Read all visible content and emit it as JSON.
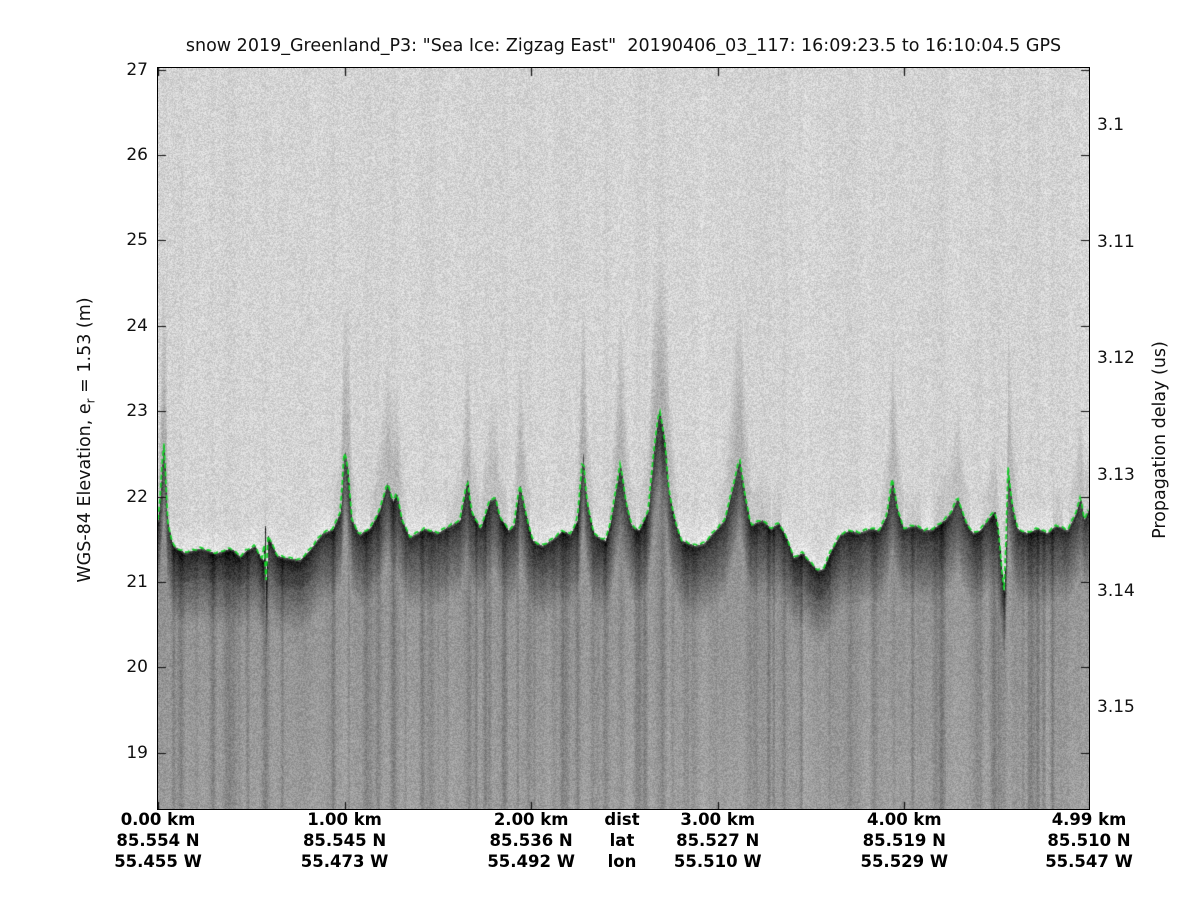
{
  "title": "snow 2019_Greenland_P3: \"Sea Ice: Zigzag East\"  20190406_03_117: 16:09:23.5 to 16:10:04.5 GPS",
  "axes": {
    "left": {
      "label_prefix": "WGS-84 Elevation, e",
      "label_sub": "r",
      "label_suffix": " = 1.53 (m)",
      "ticks": [
        27,
        26,
        25,
        24,
        23,
        22,
        21,
        20,
        19
      ]
    },
    "right": {
      "label": "Propagation delay (us)",
      "ticks": [
        3.1,
        3.11,
        3.12,
        3.13,
        3.14,
        3.15
      ],
      "tick_labels": [
        "3.1",
        "3.11",
        "3.12",
        "3.13",
        "3.14",
        "3.15"
      ]
    },
    "bottom": {
      "key": {
        "dist": "dist",
        "lat": "lat",
        "lon": "lon"
      },
      "columns": [
        {
          "km": 0,
          "dist": "0.00 km",
          "lat": "85.554 N",
          "lon": "55.455 W"
        },
        {
          "km": 1,
          "dist": "1.00 km",
          "lat": "85.545 N",
          "lon": "55.473 W"
        },
        {
          "km": 2,
          "dist": "2.00 km",
          "lat": "85.536 N",
          "lon": "55.492 W"
        },
        {
          "km": 3,
          "dist": "3.00 km",
          "lat": "85.527 N",
          "lon": "55.510 W"
        },
        {
          "km": 4,
          "dist": "4.00 km",
          "lat": "85.519 N",
          "lon": "55.529 W"
        },
        {
          "km": 4.99,
          "dist": "4.99 km",
          "lat": "85.510 N",
          "lon": "55.547 W"
        }
      ]
    }
  },
  "chart_data": {
    "type": "heatmap",
    "description": "Grayscale snow-radar echogram of sea ice (light speckle above surface, dark surface return band near 21.6 m, medium-gray subsurface clutter with vertical streaks) with a dashed green tracked-surface line overlay.",
    "xlim": [
      0,
      4.99
    ],
    "ylim_left": [
      27.02,
      18.33
    ],
    "ylim_right": [
      3.0951,
      3.1588
    ],
    "grid": false,
    "colors": {
      "surface_band": "#3a3a3a",
      "sky_speckle": "#d6d6d6",
      "subsurface": "#a2a2a2"
    },
    "surface_line": {
      "name": "tracked surface elevation",
      "style": "dashed",
      "color": "#17d32b",
      "km": [
        0.0,
        0.01,
        0.03,
        0.04,
        0.05,
        0.08,
        0.14,
        0.23,
        0.31,
        0.39,
        0.44,
        0.47,
        0.52,
        0.55,
        0.565,
        0.575,
        0.58,
        0.59,
        0.64,
        0.71,
        0.76,
        0.81,
        0.88,
        0.94,
        0.98,
        1.0,
        1.02,
        1.04,
        1.08,
        1.14,
        1.19,
        1.23,
        1.26,
        1.28,
        1.31,
        1.35,
        1.43,
        1.5,
        1.57,
        1.62,
        1.66,
        1.68,
        1.73,
        1.78,
        1.81,
        1.83,
        1.88,
        1.91,
        1.94,
        1.97,
        2.01,
        2.06,
        2.12,
        2.17,
        2.21,
        2.25,
        2.28,
        2.3,
        2.34,
        2.4,
        2.43,
        2.48,
        2.51,
        2.54,
        2.58,
        2.63,
        2.66,
        2.69,
        2.72,
        2.74,
        2.78,
        2.81,
        2.88,
        2.93,
        2.99,
        3.04,
        3.08,
        3.12,
        3.15,
        3.18,
        3.24,
        3.29,
        3.33,
        3.38,
        3.41,
        3.46,
        3.49,
        3.54,
        3.57,
        3.61,
        3.66,
        3.71,
        3.76,
        3.82,
        3.87,
        3.91,
        3.94,
        3.97,
        4.0,
        4.06,
        4.11,
        4.16,
        4.22,
        4.26,
        4.29,
        4.33,
        4.37,
        4.41,
        4.45,
        4.49,
        4.51,
        4.53,
        4.54,
        4.55,
        4.56,
        4.58,
        4.61,
        4.66,
        4.72,
        4.77,
        4.82,
        4.88,
        4.92,
        4.95,
        4.97,
        4.99
      ],
      "elev_m": [
        21.73,
        21.96,
        22.7,
        22.3,
        21.73,
        21.43,
        21.35,
        21.4,
        21.34,
        21.4,
        21.3,
        21.37,
        21.43,
        21.3,
        21.26,
        21.7,
        20.95,
        21.55,
        21.31,
        21.28,
        21.26,
        21.37,
        21.57,
        21.63,
        21.84,
        22.57,
        22.31,
        21.73,
        21.56,
        21.64,
        21.85,
        22.17,
        21.95,
        22.05,
        21.73,
        21.53,
        21.63,
        21.58,
        21.67,
        21.73,
        22.22,
        21.84,
        21.63,
        21.96,
        22.0,
        21.79,
        21.61,
        21.67,
        22.16,
        21.84,
        21.49,
        21.43,
        21.51,
        21.61,
        21.56,
        21.73,
        22.52,
        21.96,
        21.56,
        21.49,
        21.73,
        22.4,
        21.96,
        21.67,
        21.61,
        21.84,
        22.54,
        23.04,
        22.66,
        22.08,
        21.67,
        21.49,
        21.43,
        21.46,
        21.61,
        21.73,
        22.08,
        22.46,
        22.02,
        21.67,
        21.73,
        21.63,
        21.7,
        21.49,
        21.29,
        21.35,
        21.26,
        21.14,
        21.16,
        21.37,
        21.56,
        21.61,
        21.58,
        21.63,
        21.61,
        21.79,
        22.22,
        21.84,
        21.63,
        21.67,
        21.61,
        21.63,
        21.73,
        21.84,
        22.0,
        21.73,
        21.58,
        21.61,
        21.73,
        21.84,
        21.61,
        21.08,
        20.9,
        21.49,
        22.35,
        21.96,
        21.63,
        21.58,
        21.63,
        21.58,
        21.67,
        21.61,
        21.79,
        22.0,
        21.73,
        21.84
      ]
    }
  }
}
